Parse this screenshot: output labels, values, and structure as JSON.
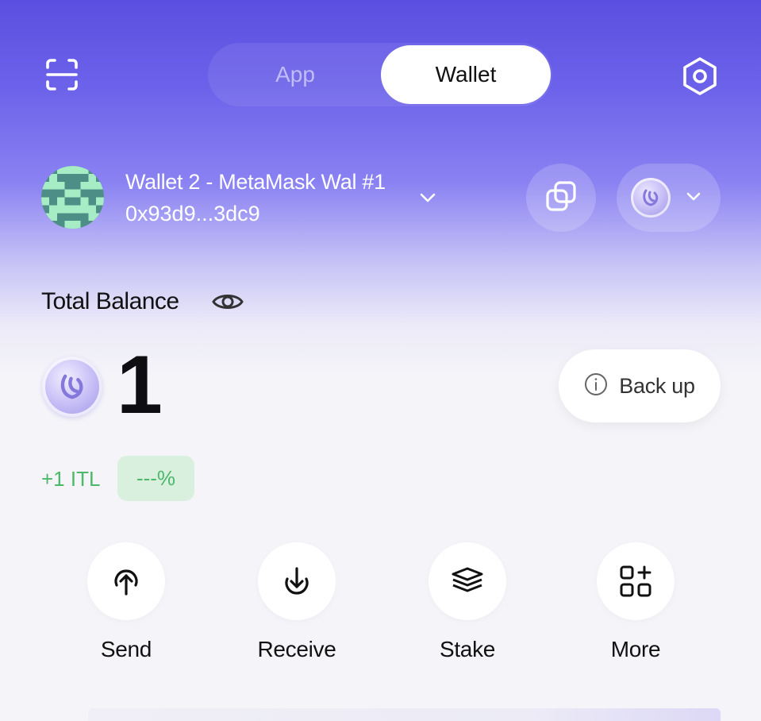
{
  "topbar": {
    "tabs": [
      {
        "label": "App",
        "active": false
      },
      {
        "label": "Wallet",
        "active": true
      }
    ],
    "scan_icon": "scan-icon",
    "settings_icon": "hexagon-settings-icon"
  },
  "account": {
    "name": "Wallet 2 - MetaMask Wal #1",
    "address": "0x93d9...3dc9",
    "avatar_colors": [
      "#4d8f86",
      "#a6ecc4"
    ]
  },
  "balance": {
    "label": "Total Balance",
    "amount": "1",
    "change_value": "+1 ITL",
    "change_percent": "---%",
    "backup_label": "Back up"
  },
  "actions": [
    {
      "label": "Send",
      "icon": "send-arrow-up-icon"
    },
    {
      "label": "Receive",
      "icon": "receive-arrow-down-icon"
    },
    {
      "label": "Stake",
      "icon": "stake-layers-icon"
    },
    {
      "label": "More",
      "icon": "more-grid-icon"
    }
  ],
  "colors": {
    "header_top": "#5a4fe0",
    "background": "#f4f4f9",
    "positive": "#4cb86a",
    "positive_bg": "#d9f0df"
  }
}
